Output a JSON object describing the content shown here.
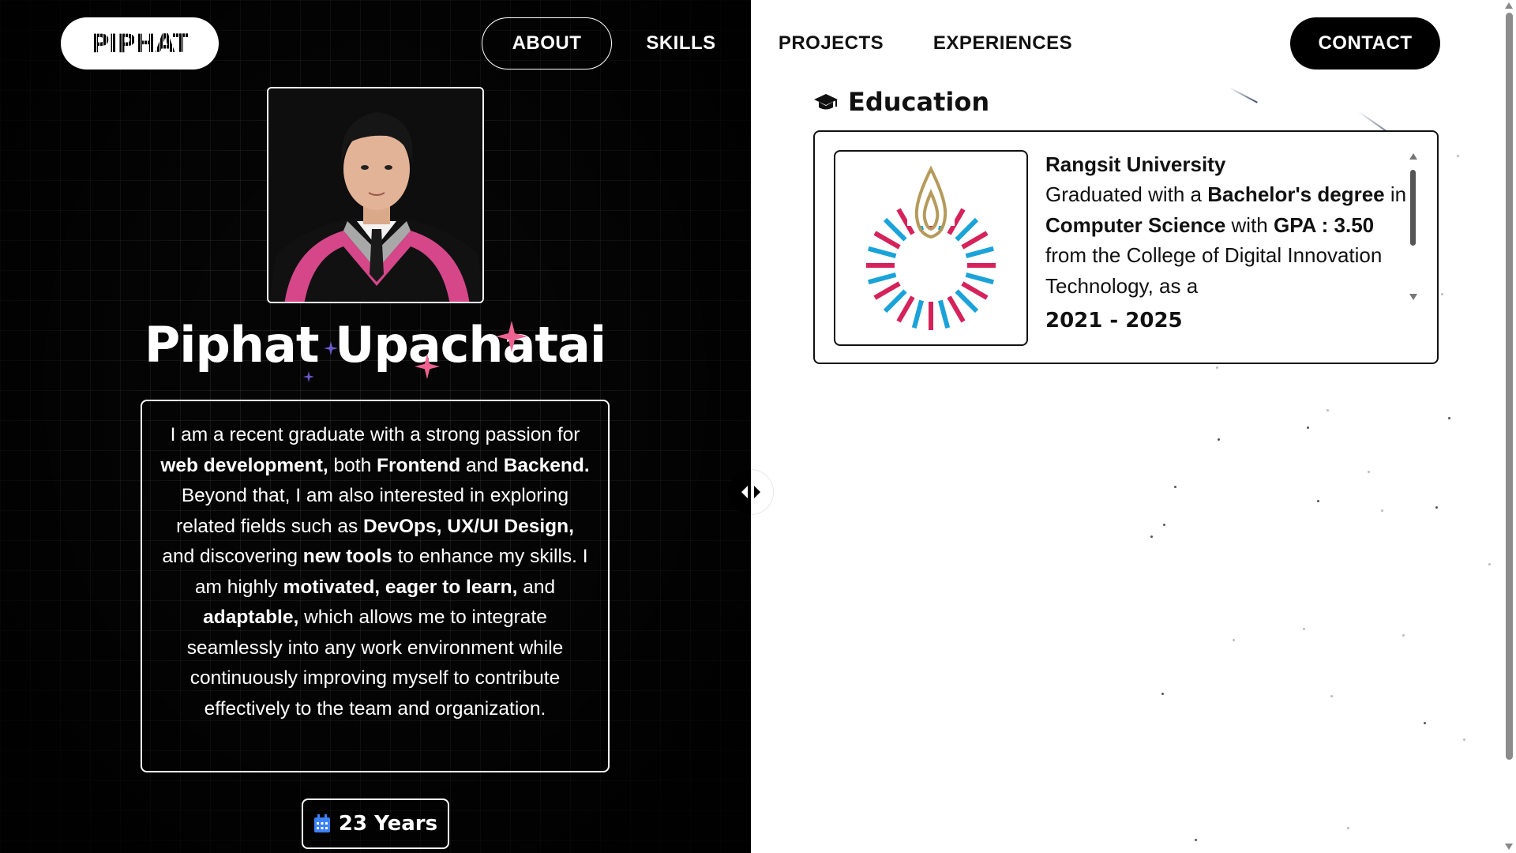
{
  "nav": {
    "logo": "PIPHAT",
    "items": [
      {
        "label": "ABOUT"
      },
      {
        "label": "SKILLS"
      },
      {
        "label": "PROJECTS"
      },
      {
        "label": "EXPERIENCES"
      }
    ],
    "contact": "CONTACT"
  },
  "profile": {
    "name": "Piphat Upachatai",
    "bio": {
      "p1": "I am a recent graduate with a strong passion for ",
      "b1": "web development,",
      "p2": " both ",
      "b2": "Frontend",
      "p3": " and ",
      "b3": "Backend.",
      "p4": " Beyond that, I am also interested in exploring related fields such as ",
      "b4": "DevOps, UX/UI Design,",
      "p5": " and discovering ",
      "b5": "new tools",
      "p6": " to enhance my skills. I am highly ",
      "b6": "motivated, eager to learn,",
      "p7": " and ",
      "b7": "adaptable,",
      "p8": " which allows me to integrate seamlessly into any work environment while continuously improving myself to contribute effectively to the team and organization."
    },
    "age": "23 Years"
  },
  "education": {
    "title": "Education",
    "school": "Rangsit University",
    "desc": {
      "p1": "Graduated with a ",
      "b1": "Bachelor's degree",
      "p2": " in ",
      "b2": "Computer Science",
      "p3": " with ",
      "b3": "GPA : 3.50",
      "p4": " from the College of Digital Innovation Technology, as a"
    },
    "years": "2021 - 2025"
  },
  "icons": {
    "education": "graduation-cap-icon",
    "age": "calendar-icon",
    "divider": "split-handle-icon"
  },
  "colors": {
    "dark_bg": "#050505",
    "accent_pink": "#f06292",
    "calendar_blue": "#3b82f6"
  }
}
